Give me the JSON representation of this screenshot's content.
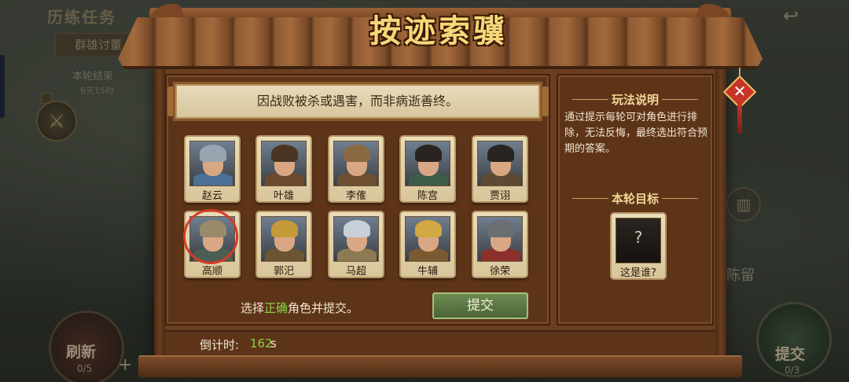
{
  "background": {
    "panel_title": "历练任务",
    "tab": "群雄讨董",
    "round_status": "本轮结束",
    "round_countdown": "6天15时",
    "refresh_label": "刷新",
    "refresh_count": "0/5",
    "submit_label": "提交",
    "submit_count": "0/3",
    "city_label": "陈留",
    "icons": [
      "back-arrow-icon",
      "crossed-swords-icon",
      "tower-icon"
    ]
  },
  "dialog": {
    "title": "按迹索骥",
    "clue": "因战败被杀或遇害，而非病逝善终。",
    "characters": [
      {
        "name": "赵云",
        "helm": "#9aa3b0",
        "armor": "#4b6f95",
        "selected": false
      },
      {
        "name": "叶雄",
        "helm": "#4a3524",
        "armor": "#6b4a2e",
        "selected": false
      },
      {
        "name": "李傕",
        "helm": "#8a6a43",
        "armor": "#6e4f30",
        "selected": false
      },
      {
        "name": "陈宫",
        "helm": "#2a2420",
        "armor": "#3d5c4a",
        "selected": false
      },
      {
        "name": "贾诩",
        "helm": "#2a2420",
        "armor": "#5e4a32",
        "selected": false
      },
      {
        "name": "高顺",
        "helm": "#9a8a6c",
        "armor": "#4d5e52",
        "selected": true
      },
      {
        "name": "郭汜",
        "helm": "#c49a3a",
        "armor": "#6b5532",
        "selected": false
      },
      {
        "name": "马超",
        "helm": "#c7cfd8",
        "armor": "#8d7a55",
        "selected": false
      },
      {
        "name": "牛辅",
        "helm": "#d2a843",
        "armor": "#7a5a30",
        "selected": false
      },
      {
        "name": "徐荣",
        "helm": "#6c6f72",
        "armor": "#8b2f2a",
        "selected": false
      }
    ],
    "instruction_before": "选择",
    "instruction_highlight": "正确",
    "instruction_after": "角色并提交。",
    "submit_button": "提交",
    "timer_label": "倒计时:",
    "timer_value": "162",
    "timer_unit": "s",
    "rules_title": "玩法说明",
    "rules_text": "通过提示每轮可对角色进行排除，无法反悔，最终选出符合预期的答案。",
    "goal_title": "本轮目标",
    "mystery_mark": "?",
    "mystery_name": "这是谁?",
    "close_icon": "close-icon",
    "colors": {
      "highlight": "#88d34a",
      "title": "#f6d77a",
      "panel": "#5e3419",
      "selection_ring": "#d43a2a"
    }
  }
}
